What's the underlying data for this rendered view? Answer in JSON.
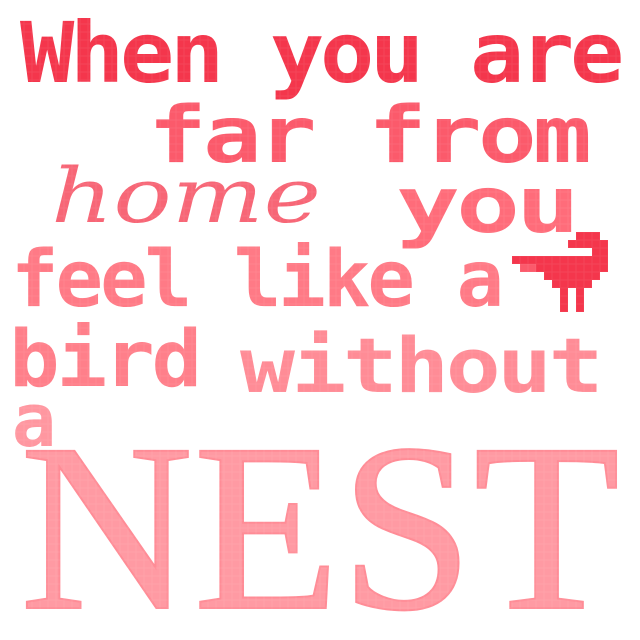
{
  "lines": {
    "line1": "When you are",
    "line2": "far from",
    "script_word": "home",
    "line3_right": "you",
    "line4": "feel like a",
    "line5_left": "bird",
    "line5_right": "without",
    "line6": "a",
    "big_word": "NEST"
  },
  "colors": {
    "red_dark": "#f4364c",
    "red_mid": "#fb5a6b",
    "pink_mid": "#ff7a86",
    "pink_light": "#ff97a0",
    "pink_lighter": "#ffaab0"
  },
  "icons": {
    "bird": "bird-icon"
  }
}
